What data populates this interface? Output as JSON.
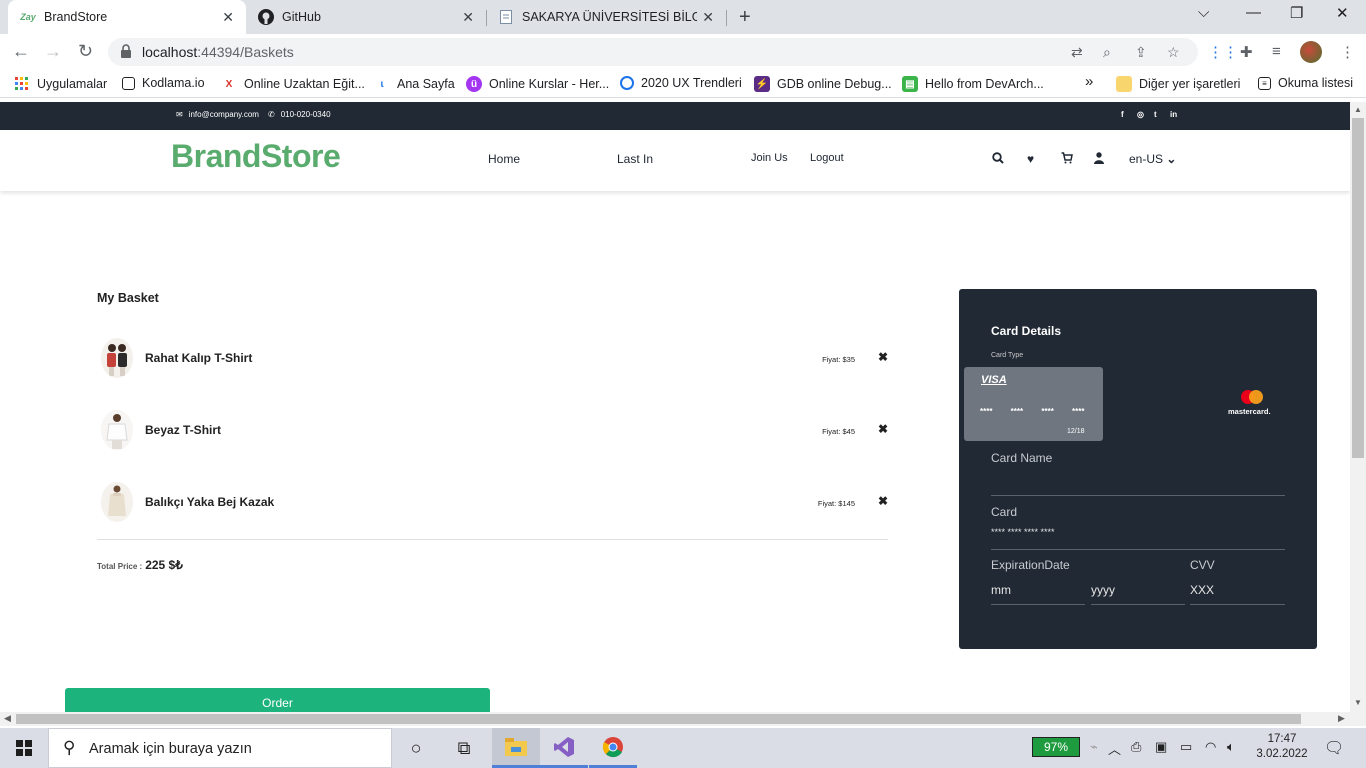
{
  "browser": {
    "tabs": [
      {
        "title": "BrandStore",
        "favicon": "Zay",
        "active": true
      },
      {
        "title": "GitHub",
        "favicon": "github-icon",
        "active": false
      },
      {
        "title": "SAKARYA ÜNİVERSİTESİ BİLGİ SİS",
        "favicon": "doc-icon",
        "active": false
      }
    ],
    "url_host": "localhost",
    "url_path": ":44394/Baskets",
    "bookmarks": [
      "Uygulamalar",
      "Kodlama.io",
      "Online Uzaktan Eğit...",
      "Ana Sayfa",
      "Online Kurslar - Her...",
      "2020 UX Trendleri",
      "GDB online Debug...",
      "Hello from DevArch..."
    ],
    "bookmarks_more": "»",
    "other_bookmarks": "Diğer yer işaretleri",
    "reading_list": "Okuma listesi"
  },
  "site": {
    "email": "info@company.com",
    "phone": "010-020-0340",
    "social": [
      "f",
      "◎",
      "t",
      "in"
    ],
    "brand": "BrandStore",
    "nav": [
      "Home",
      "Last In",
      "Join Us",
      "Logout"
    ],
    "lang": "en-US"
  },
  "basket": {
    "title": "My Basket",
    "items": [
      {
        "name": "Rahat Kalıp T-Shirt",
        "price": "Fiyat: $35"
      },
      {
        "name": "Beyaz T-Shirt",
        "price": "Fiyat: $45"
      },
      {
        "name": "Balıkçı Yaka Bej Kazak",
        "price": "Fiyat: $145"
      }
    ],
    "total_label": "Total Price :",
    "total_value": "225 $₺",
    "order_label": "Order"
  },
  "card": {
    "title": "Card Details",
    "type_label": "Card Type",
    "visa": "VISA",
    "digits": "**** **** **** ****",
    "expiry": "12/18",
    "mastercard": "mastercard.",
    "name_label": "Card Name",
    "card_label": "Card",
    "card_value": "**** **** **** ****",
    "expiration_label": "ExpirationDate",
    "mm": "mm",
    "yyyy": "yyyy",
    "cvv_label": "CVV",
    "cvv_value": "XXX"
  },
  "taskbar": {
    "search_placeholder": "Aramak için buraya yazın",
    "battery": "97%",
    "time": "17:47",
    "date": "3.02.2022"
  },
  "colors": {
    "brand_green": "#59ab6e",
    "order_green": "#1db37c",
    "dark_navy": "#212934"
  }
}
